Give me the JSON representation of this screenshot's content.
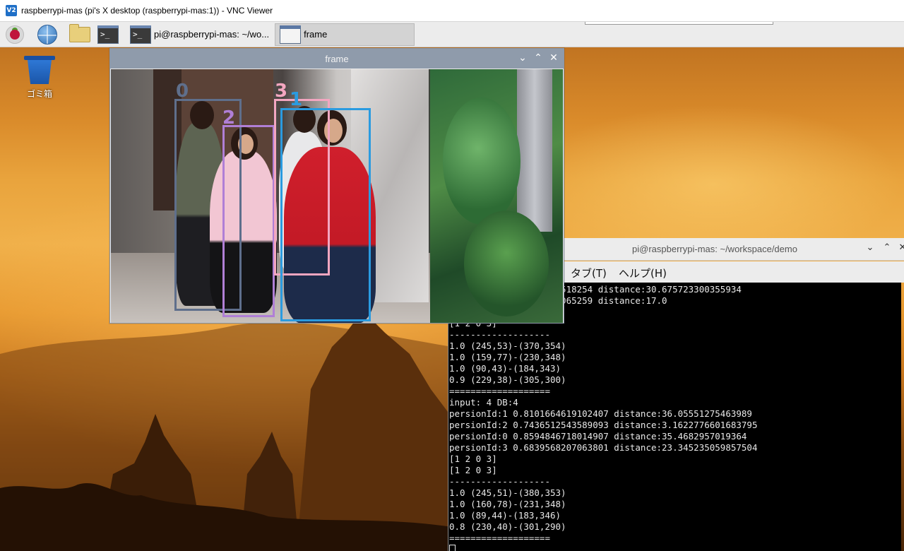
{
  "vnc": {
    "title": "raspberrypi-mas (pi's X desktop (raspberrypi-mas:1)) - VNC Viewer",
    "logo": "V2"
  },
  "taskbar": {
    "items": [
      {
        "label": "pi@raspberrypi-mas: ~/wo...",
        "icon": "terminal-icon"
      },
      {
        "label": "frame",
        "icon": "window-icon"
      }
    ],
    "terminal_glyph": ">_"
  },
  "desktop": {
    "trash_label": "ゴミ箱"
  },
  "frame_window": {
    "title": "frame",
    "buttons": {
      "minimize": "⌄",
      "maximize": "⌃",
      "close": "✕"
    },
    "boxes": [
      {
        "id": "0",
        "color": "#5f6f8c"
      },
      {
        "id": "2",
        "color": "#b07fd6"
      },
      {
        "id": "3",
        "color": "#f3a6c0"
      },
      {
        "id": "1",
        "color": "#2a9be0"
      }
    ]
  },
  "terminal": {
    "title": "pi@raspberrypi-mas: ~/workspace/demo",
    "menu": [
      "タブ(T)",
      "ヘルプ(H)"
    ],
    "buttons": {
      "minimize": "⌄",
      "maximize": "⌃",
      "close": "✕"
    },
    "lines": [
      "                 2883518254 distance:30.675723300355934",
      "                 1358065259 distance:17.0",
      "",
      "[1 2 0 3]",
      "-------------------",
      "1.0 (245,53)-(370,354)",
      "1.0 (159,77)-(230,348)",
      "1.0 (90,43)-(184,343)",
      "0.9 (229,38)-(305,300)",
      "===================",
      "input: 4 DB:4",
      "persionId:1 0.8101664619102407 distance:36.05551275463989",
      "persionId:2 0.7436512543589093 distance:3.1622776601683795",
      "persionId:0 0.8594846718014907 distance:35.4682957019364",
      "persionId:3 0.6839568207063801 distance:23.345235059857504",
      "[1 2 0 3]",
      "[1 2 0 3]",
      "-------------------",
      "1.0 (245,51)-(380,353)",
      "1.0 (160,78)-(231,348)",
      "1.0 (89,44)-(183,346)",
      "0.8 (230,40)-(301,290)",
      "==================="
    ]
  }
}
